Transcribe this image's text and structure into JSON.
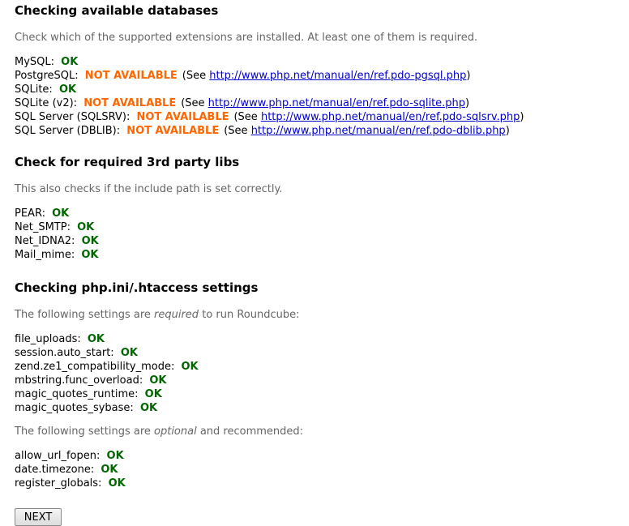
{
  "databases": {
    "title": "Checking available databases",
    "hint": "Check which of the supported extensions are installed. At least one of them is required.",
    "items": [
      {
        "label": "MySQL:",
        "status": "OK"
      },
      {
        "label": "PostgreSQL:",
        "status": "NOT AVAILABLE",
        "see_prefix": "(See",
        "link": "http://www.php.net/manual/en/ref.pdo-pgsql.php",
        "see_suffix": ")"
      },
      {
        "label": "SQLite:",
        "status": "OK"
      },
      {
        "label": "SQLite (v2):",
        "status": "NOT AVAILABLE",
        "see_prefix": "(See",
        "link": "http://www.php.net/manual/en/ref.pdo-sqlite.php",
        "see_suffix": ")"
      },
      {
        "label": "SQL Server (SQLSRV):",
        "status": "NOT AVAILABLE",
        "see_prefix": "(See",
        "link": "http://www.php.net/manual/en/ref.pdo-sqlsrv.php",
        "see_suffix": ")"
      },
      {
        "label": "SQL Server (DBLIB):",
        "status": "NOT AVAILABLE",
        "see_prefix": "(See",
        "link": "http://www.php.net/manual/en/ref.pdo-dblib.php",
        "see_suffix": ")"
      }
    ]
  },
  "libs": {
    "title": "Check for required 3rd party libs",
    "hint": "This also checks if the include path is set correctly.",
    "items": [
      {
        "label": "PEAR:",
        "status": "OK"
      },
      {
        "label": "Net_SMTP:",
        "status": "OK"
      },
      {
        "label": "Net_IDNA2:",
        "status": "OK"
      },
      {
        "label": "Mail_mime:",
        "status": "OK"
      }
    ]
  },
  "settings": {
    "title": "Checking php.ini/.htaccess settings",
    "required_hint_pre": "The following settings are ",
    "required_hint_em": "required",
    "required_hint_post": " to run Roundcube:",
    "required_items": [
      {
        "label": "file_uploads:",
        "status": "OK"
      },
      {
        "label": "session.auto_start:",
        "status": "OK"
      },
      {
        "label": "zend.ze1_compatibility_mode:",
        "status": "OK"
      },
      {
        "label": "mbstring.func_overload:",
        "status": "OK"
      },
      {
        "label": "magic_quotes_runtime:",
        "status": "OK"
      },
      {
        "label": "magic_quotes_sybase:",
        "status": "OK"
      }
    ],
    "optional_hint_pre": "The following settings are ",
    "optional_hint_em": "optional",
    "optional_hint_post": " and recommended:",
    "optional_items": [
      {
        "label": "allow_url_fopen:",
        "status": "OK"
      },
      {
        "label": "date.timezone:",
        "status": "OK"
      },
      {
        "label": "register_globals:",
        "status": "OK"
      }
    ]
  },
  "next_button": "NEXT",
  "colors": {
    "ok": "#006600",
    "not_available": "#ff6600",
    "link": "#0000cc",
    "hint": "#666666"
  }
}
